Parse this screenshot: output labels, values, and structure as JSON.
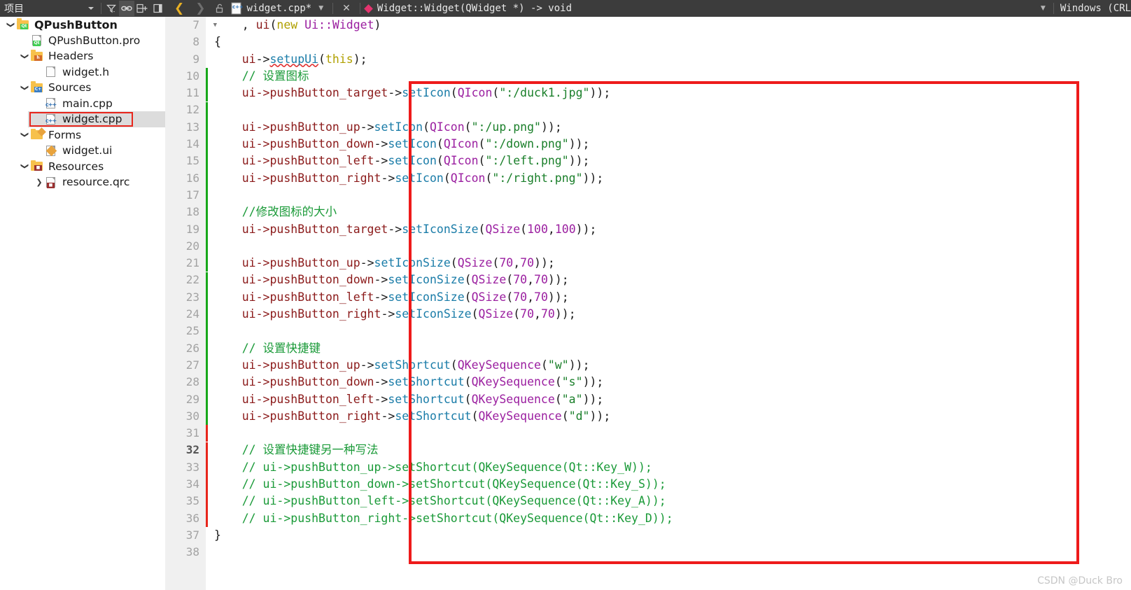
{
  "topbar": {
    "projects_label": "项目",
    "dropdown_icon": "chevron-down-icon",
    "filter_icon": "filter-icon",
    "link_icon": "link-icon",
    "split_icon": "split-add-icon",
    "close_panel_icon": "close-panel-icon",
    "back_icon": "back-arrow-icon",
    "forward_icon": "forward-arrow-icon",
    "lock_icon": "unlock-icon",
    "file_type_icon": "cpp-file-icon",
    "filename": "widget.cpp*",
    "file_dropdown_icon": "chevron-down-icon",
    "close_icon": "✕",
    "symbol_marker_icon": "function-diamond-icon",
    "symbol": "Widget::Widget(QWidget *) -> void",
    "eol_dropdown_icon": "chevron-down-icon",
    "eol": "Windows (CRL"
  },
  "sidebar": {
    "items": [
      {
        "label": "QPushButton",
        "indent": 0,
        "arrow": "v",
        "icon": "qt-project-folder-icon",
        "bold": true,
        "name": "tree-item-qpushbutton"
      },
      {
        "label": "QPushButton.pro",
        "indent": 1,
        "arrow": "",
        "icon": "qt-pro-file-icon",
        "bold": false,
        "name": "tree-item-qpushbutton-pro"
      },
      {
        "label": "Headers",
        "indent": 1,
        "arrow": "v",
        "icon": "headers-folder-icon",
        "bold": false,
        "name": "tree-item-headers"
      },
      {
        "label": "widget.h",
        "indent": 2,
        "arrow": "",
        "icon": "header-file-icon",
        "bold": false,
        "name": "tree-item-widget-h"
      },
      {
        "label": "Sources",
        "indent": 1,
        "arrow": "v",
        "icon": "sources-folder-icon",
        "bold": false,
        "name": "tree-item-sources"
      },
      {
        "label": "main.cpp",
        "indent": 2,
        "arrow": "",
        "icon": "cpp-file-icon",
        "bold": false,
        "name": "tree-item-main-cpp"
      },
      {
        "label": "widget.cpp",
        "indent": 2,
        "arrow": "",
        "icon": "cpp-file-icon",
        "bold": false,
        "name": "tree-item-widget-cpp",
        "selected": true,
        "highlighted": true
      },
      {
        "label": "Forms",
        "indent": 1,
        "arrow": "v",
        "icon": "forms-folder-icon",
        "bold": false,
        "name": "tree-item-forms"
      },
      {
        "label": "widget.ui",
        "indent": 2,
        "arrow": "",
        "icon": "ui-file-icon",
        "bold": false,
        "name": "tree-item-widget-ui"
      },
      {
        "label": "Resources",
        "indent": 1,
        "arrow": "v",
        "icon": "resources-folder-icon",
        "bold": false,
        "name": "tree-item-resources"
      },
      {
        "label": "resource.qrc",
        "indent": 2,
        "arrow": ">",
        "icon": "qrc-file-icon",
        "bold": false,
        "name": "tree-item-resource-qrc"
      }
    ]
  },
  "editor": {
    "current_line": 32,
    "lines": [
      {
        "n": 7,
        "fold": true,
        "change": "",
        "tokens": [
          {
            "t": "plain",
            "s": "    , "
          },
          {
            "t": "member",
            "s": "ui"
          },
          {
            "t": "punct",
            "s": "("
          },
          {
            "t": "kw",
            "s": "new"
          },
          {
            "t": "plain",
            "s": " "
          },
          {
            "t": "type",
            "s": "Ui::Widget"
          },
          {
            "t": "punct",
            "s": ")"
          }
        ]
      },
      {
        "n": 8,
        "fold": false,
        "change": "",
        "tokens": [
          {
            "t": "punct",
            "s": "{"
          }
        ]
      },
      {
        "n": 9,
        "fold": false,
        "change": "",
        "tokens": [
          {
            "t": "plain",
            "s": "    "
          },
          {
            "t": "member",
            "s": "ui"
          },
          {
            "t": "punct",
            "s": "->"
          },
          {
            "t": "func squiggle",
            "s": "setupUi"
          },
          {
            "t": "punct",
            "s": "("
          },
          {
            "t": "kw",
            "s": "this"
          },
          {
            "t": "punct",
            "s": ");"
          }
        ]
      },
      {
        "n": 10,
        "fold": false,
        "change": "green",
        "tokens": [
          {
            "t": "plain",
            "s": "    "
          },
          {
            "t": "comment",
            "s": "// 设置图标"
          }
        ]
      },
      {
        "n": 11,
        "fold": false,
        "change": "green",
        "tokens": [
          {
            "t": "plain",
            "s": "    "
          },
          {
            "t": "member",
            "s": "ui->pushButton_target"
          },
          {
            "t": "punct",
            "s": "->"
          },
          {
            "t": "func",
            "s": "setIcon"
          },
          {
            "t": "punct",
            "s": "("
          },
          {
            "t": "type",
            "s": "QIcon"
          },
          {
            "t": "punct",
            "s": "("
          },
          {
            "t": "str",
            "s": "\":/duck1.jpg\""
          },
          {
            "t": "punct",
            "s": "));"
          }
        ]
      },
      {
        "n": 12,
        "fold": false,
        "change": "green",
        "tokens": []
      },
      {
        "n": 13,
        "fold": false,
        "change": "green",
        "tokens": [
          {
            "t": "plain",
            "s": "    "
          },
          {
            "t": "member",
            "s": "ui->pushButton_up"
          },
          {
            "t": "punct",
            "s": "->"
          },
          {
            "t": "func",
            "s": "setIcon"
          },
          {
            "t": "punct",
            "s": "("
          },
          {
            "t": "type",
            "s": "QIcon"
          },
          {
            "t": "punct",
            "s": "("
          },
          {
            "t": "str",
            "s": "\":/up.png\""
          },
          {
            "t": "punct",
            "s": "));"
          }
        ]
      },
      {
        "n": 14,
        "fold": false,
        "change": "green",
        "tokens": [
          {
            "t": "plain",
            "s": "    "
          },
          {
            "t": "member",
            "s": "ui->pushButton_down"
          },
          {
            "t": "punct",
            "s": "->"
          },
          {
            "t": "func",
            "s": "setIcon"
          },
          {
            "t": "punct",
            "s": "("
          },
          {
            "t": "type",
            "s": "QIcon"
          },
          {
            "t": "punct",
            "s": "("
          },
          {
            "t": "str",
            "s": "\":/down.png\""
          },
          {
            "t": "punct",
            "s": "));"
          }
        ]
      },
      {
        "n": 15,
        "fold": false,
        "change": "green",
        "tokens": [
          {
            "t": "plain",
            "s": "    "
          },
          {
            "t": "member",
            "s": "ui->pushButton_left"
          },
          {
            "t": "punct",
            "s": "->"
          },
          {
            "t": "func",
            "s": "setIcon"
          },
          {
            "t": "punct",
            "s": "("
          },
          {
            "t": "type",
            "s": "QIcon"
          },
          {
            "t": "punct",
            "s": "("
          },
          {
            "t": "str",
            "s": "\":/left.png\""
          },
          {
            "t": "punct",
            "s": "));"
          }
        ]
      },
      {
        "n": 16,
        "fold": false,
        "change": "green",
        "tokens": [
          {
            "t": "plain",
            "s": "    "
          },
          {
            "t": "member",
            "s": "ui->pushButton_right"
          },
          {
            "t": "punct",
            "s": "->"
          },
          {
            "t": "func",
            "s": "setIcon"
          },
          {
            "t": "punct",
            "s": "("
          },
          {
            "t": "type",
            "s": "QIcon"
          },
          {
            "t": "punct",
            "s": "("
          },
          {
            "t": "str",
            "s": "\":/right.png\""
          },
          {
            "t": "punct",
            "s": "));"
          }
        ]
      },
      {
        "n": 17,
        "fold": false,
        "change": "green",
        "tokens": []
      },
      {
        "n": 18,
        "fold": false,
        "change": "green",
        "tokens": [
          {
            "t": "plain",
            "s": "    "
          },
          {
            "t": "comment",
            "s": "//修改图标的大小"
          }
        ]
      },
      {
        "n": 19,
        "fold": false,
        "change": "green",
        "tokens": [
          {
            "t": "plain",
            "s": "    "
          },
          {
            "t": "member",
            "s": "ui->pushButton_target"
          },
          {
            "t": "punct",
            "s": "->"
          },
          {
            "t": "func",
            "s": "setIconSize"
          },
          {
            "t": "punct",
            "s": "("
          },
          {
            "t": "type",
            "s": "QSize"
          },
          {
            "t": "punct",
            "s": "("
          },
          {
            "t": "num",
            "s": "100"
          },
          {
            "t": "punct",
            "s": ","
          },
          {
            "t": "num",
            "s": "100"
          },
          {
            "t": "punct",
            "s": "));"
          }
        ]
      },
      {
        "n": 20,
        "fold": false,
        "change": "green",
        "tokens": []
      },
      {
        "n": 21,
        "fold": false,
        "change": "green",
        "tokens": [
          {
            "t": "plain",
            "s": "    "
          },
          {
            "t": "member",
            "s": "ui->pushButton_up"
          },
          {
            "t": "punct",
            "s": "->"
          },
          {
            "t": "func",
            "s": "setIconSize"
          },
          {
            "t": "punct",
            "s": "("
          },
          {
            "t": "type",
            "s": "QSize"
          },
          {
            "t": "punct",
            "s": "("
          },
          {
            "t": "num",
            "s": "70"
          },
          {
            "t": "punct",
            "s": ","
          },
          {
            "t": "num",
            "s": "70"
          },
          {
            "t": "punct",
            "s": "));"
          }
        ]
      },
      {
        "n": 22,
        "fold": false,
        "change": "green",
        "tokens": [
          {
            "t": "plain",
            "s": "    "
          },
          {
            "t": "member",
            "s": "ui->pushButton_down"
          },
          {
            "t": "punct",
            "s": "->"
          },
          {
            "t": "func",
            "s": "setIconSize"
          },
          {
            "t": "punct",
            "s": "("
          },
          {
            "t": "type",
            "s": "QSize"
          },
          {
            "t": "punct",
            "s": "("
          },
          {
            "t": "num",
            "s": "70"
          },
          {
            "t": "punct",
            "s": ","
          },
          {
            "t": "num",
            "s": "70"
          },
          {
            "t": "punct",
            "s": "));"
          }
        ]
      },
      {
        "n": 23,
        "fold": false,
        "change": "green",
        "tokens": [
          {
            "t": "plain",
            "s": "    "
          },
          {
            "t": "member",
            "s": "ui->pushButton_left"
          },
          {
            "t": "punct",
            "s": "->"
          },
          {
            "t": "func",
            "s": "setIconSize"
          },
          {
            "t": "punct",
            "s": "("
          },
          {
            "t": "type",
            "s": "QSize"
          },
          {
            "t": "punct",
            "s": "("
          },
          {
            "t": "num",
            "s": "70"
          },
          {
            "t": "punct",
            "s": ","
          },
          {
            "t": "num",
            "s": "70"
          },
          {
            "t": "punct",
            "s": "));"
          }
        ]
      },
      {
        "n": 24,
        "fold": false,
        "change": "green",
        "tokens": [
          {
            "t": "plain",
            "s": "    "
          },
          {
            "t": "member",
            "s": "ui->pushButton_right"
          },
          {
            "t": "punct",
            "s": "->"
          },
          {
            "t": "func",
            "s": "setIconSize"
          },
          {
            "t": "punct",
            "s": "("
          },
          {
            "t": "type",
            "s": "QSize"
          },
          {
            "t": "punct",
            "s": "("
          },
          {
            "t": "num",
            "s": "70"
          },
          {
            "t": "punct",
            "s": ","
          },
          {
            "t": "num",
            "s": "70"
          },
          {
            "t": "punct",
            "s": "));"
          }
        ]
      },
      {
        "n": 25,
        "fold": false,
        "change": "green",
        "tokens": []
      },
      {
        "n": 26,
        "fold": false,
        "change": "green",
        "tokens": [
          {
            "t": "plain",
            "s": "    "
          },
          {
            "t": "comment",
            "s": "// 设置快捷键"
          }
        ]
      },
      {
        "n": 27,
        "fold": false,
        "change": "green",
        "tokens": [
          {
            "t": "plain",
            "s": "    "
          },
          {
            "t": "member",
            "s": "ui->pushButton_up"
          },
          {
            "t": "punct",
            "s": "->"
          },
          {
            "t": "func",
            "s": "setShortcut"
          },
          {
            "t": "punct",
            "s": "("
          },
          {
            "t": "type",
            "s": "QKeySequence"
          },
          {
            "t": "punct",
            "s": "("
          },
          {
            "t": "str",
            "s": "\"w\""
          },
          {
            "t": "punct",
            "s": "));"
          }
        ]
      },
      {
        "n": 28,
        "fold": false,
        "change": "green",
        "tokens": [
          {
            "t": "plain",
            "s": "    "
          },
          {
            "t": "member",
            "s": "ui->pushButton_down"
          },
          {
            "t": "punct",
            "s": "->"
          },
          {
            "t": "func",
            "s": "setShortcut"
          },
          {
            "t": "punct",
            "s": "("
          },
          {
            "t": "type",
            "s": "QKeySequence"
          },
          {
            "t": "punct",
            "s": "("
          },
          {
            "t": "str",
            "s": "\"s\""
          },
          {
            "t": "punct",
            "s": "));"
          }
        ]
      },
      {
        "n": 29,
        "fold": false,
        "change": "green",
        "tokens": [
          {
            "t": "plain",
            "s": "    "
          },
          {
            "t": "member",
            "s": "ui->pushButton_left"
          },
          {
            "t": "punct",
            "s": "->"
          },
          {
            "t": "func",
            "s": "setShortcut"
          },
          {
            "t": "punct",
            "s": "("
          },
          {
            "t": "type",
            "s": "QKeySequence"
          },
          {
            "t": "punct",
            "s": "("
          },
          {
            "t": "str",
            "s": "\"a\""
          },
          {
            "t": "punct",
            "s": "));"
          }
        ]
      },
      {
        "n": 30,
        "fold": false,
        "change": "green",
        "tokens": [
          {
            "t": "plain",
            "s": "    "
          },
          {
            "t": "member",
            "s": "ui->pushButton_right"
          },
          {
            "t": "punct",
            "s": "->"
          },
          {
            "t": "func",
            "s": "setShortcut"
          },
          {
            "t": "punct",
            "s": "("
          },
          {
            "t": "type",
            "s": "QKeySequence"
          },
          {
            "t": "punct",
            "s": "("
          },
          {
            "t": "str",
            "s": "\"d\""
          },
          {
            "t": "punct",
            "s": "));"
          }
        ]
      },
      {
        "n": 31,
        "fold": false,
        "change": "red",
        "tokens": []
      },
      {
        "n": 32,
        "fold": false,
        "change": "red",
        "tokens": [
          {
            "t": "plain",
            "s": "    "
          },
          {
            "t": "comment",
            "s": "// 设置快捷键另一种写法"
          }
        ]
      },
      {
        "n": 33,
        "fold": false,
        "change": "red",
        "tokens": [
          {
            "t": "plain",
            "s": "    "
          },
          {
            "t": "comment",
            "s": "// ui->pushButton_up->setShortcut(QKeySequence(Qt::Key_W));"
          }
        ]
      },
      {
        "n": 34,
        "fold": false,
        "change": "red",
        "tokens": [
          {
            "t": "plain",
            "s": "    "
          },
          {
            "t": "comment",
            "s": "// ui->pushButton_down->setShortcut(QKeySequence(Qt::Key_S));"
          }
        ]
      },
      {
        "n": 35,
        "fold": false,
        "change": "red",
        "tokens": [
          {
            "t": "plain",
            "s": "    "
          },
          {
            "t": "comment",
            "s": "// ui->pushButton_left->setShortcut(QKeySequence(Qt::Key_A));"
          }
        ]
      },
      {
        "n": 36,
        "fold": false,
        "change": "red",
        "tokens": [
          {
            "t": "plain",
            "s": "    "
          },
          {
            "t": "comment",
            "s": "// ui->pushButton_right->setShortcut(QKeySequence(Qt::Key_D));"
          }
        ]
      },
      {
        "n": 37,
        "fold": false,
        "change": "",
        "tokens": [
          {
            "t": "punct",
            "s": "}"
          }
        ]
      },
      {
        "n": 38,
        "fold": false,
        "change": "",
        "tokens": []
      }
    ]
  },
  "watermark": "CSDN @Duck Bro",
  "colors": {
    "accent_red_box": "#ee1b1b",
    "topbar_bg": "#3c3c3c",
    "gutter_bg": "#f0f0f0",
    "change_added": "#17a81a",
    "change_modified": "#e8261c",
    "selection": "#dcdcdc"
  }
}
